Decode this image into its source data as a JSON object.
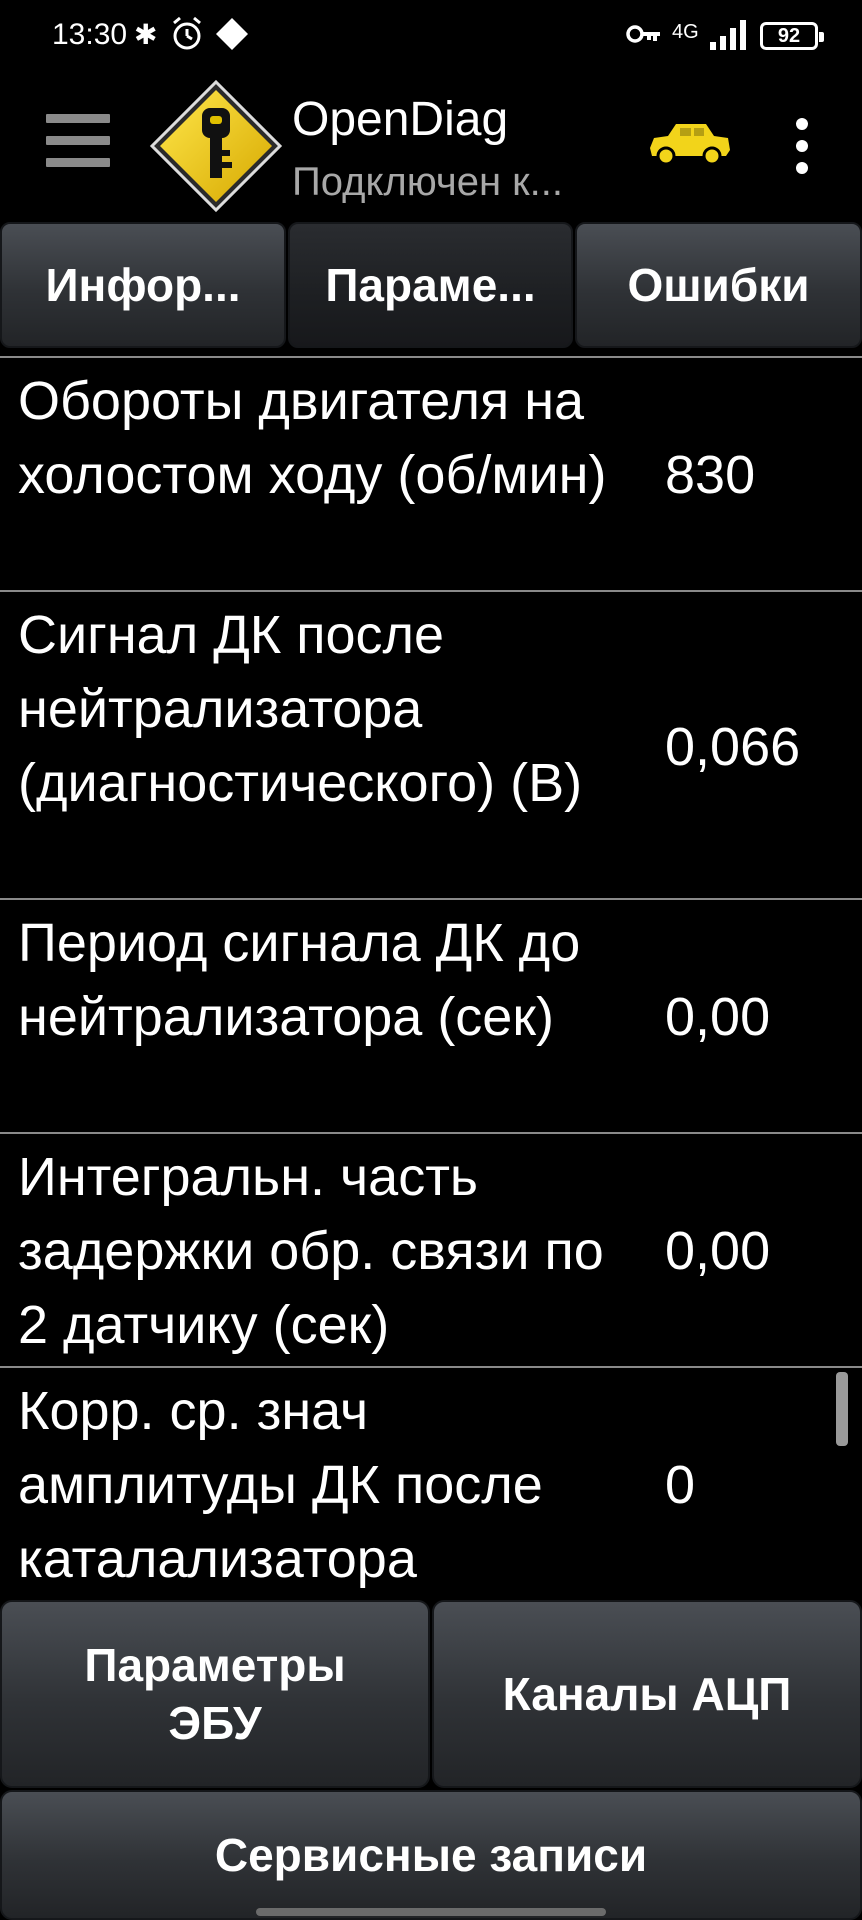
{
  "status_bar": {
    "time": "13:30",
    "network": "4G",
    "battery": "92"
  },
  "app_bar": {
    "title": "OpenDiag",
    "subtitle": "Подключен к...",
    "accent_color": "#f2d41a"
  },
  "tabs": [
    {
      "label": "Инфор..."
    },
    {
      "label": "Параме..."
    },
    {
      "label": "Ошибки"
    }
  ],
  "parameters": [
    {
      "name": "Обороты двигателя на холостом ходу (об/мин)",
      "value": "830"
    },
    {
      "name": "Сигнал ДК после нейтрализатора (диагностического) (В)",
      "value": "0,066"
    },
    {
      "name": "Период сигнала ДК до нейтрализатора (сек)",
      "value": "0,00"
    },
    {
      "name": "Интегральн. часть задержки обр. связи по 2 датчику (сек)",
      "value": "0,00"
    },
    {
      "name": "Корр. ср. знач амплитуды ДК после каталализатора",
      "value": "0"
    }
  ],
  "bottom_buttons": {
    "ecu_params": "Параметры ЭБУ",
    "adc_channels": "Каналы АЦП",
    "service_records": "Сервисные записи"
  }
}
